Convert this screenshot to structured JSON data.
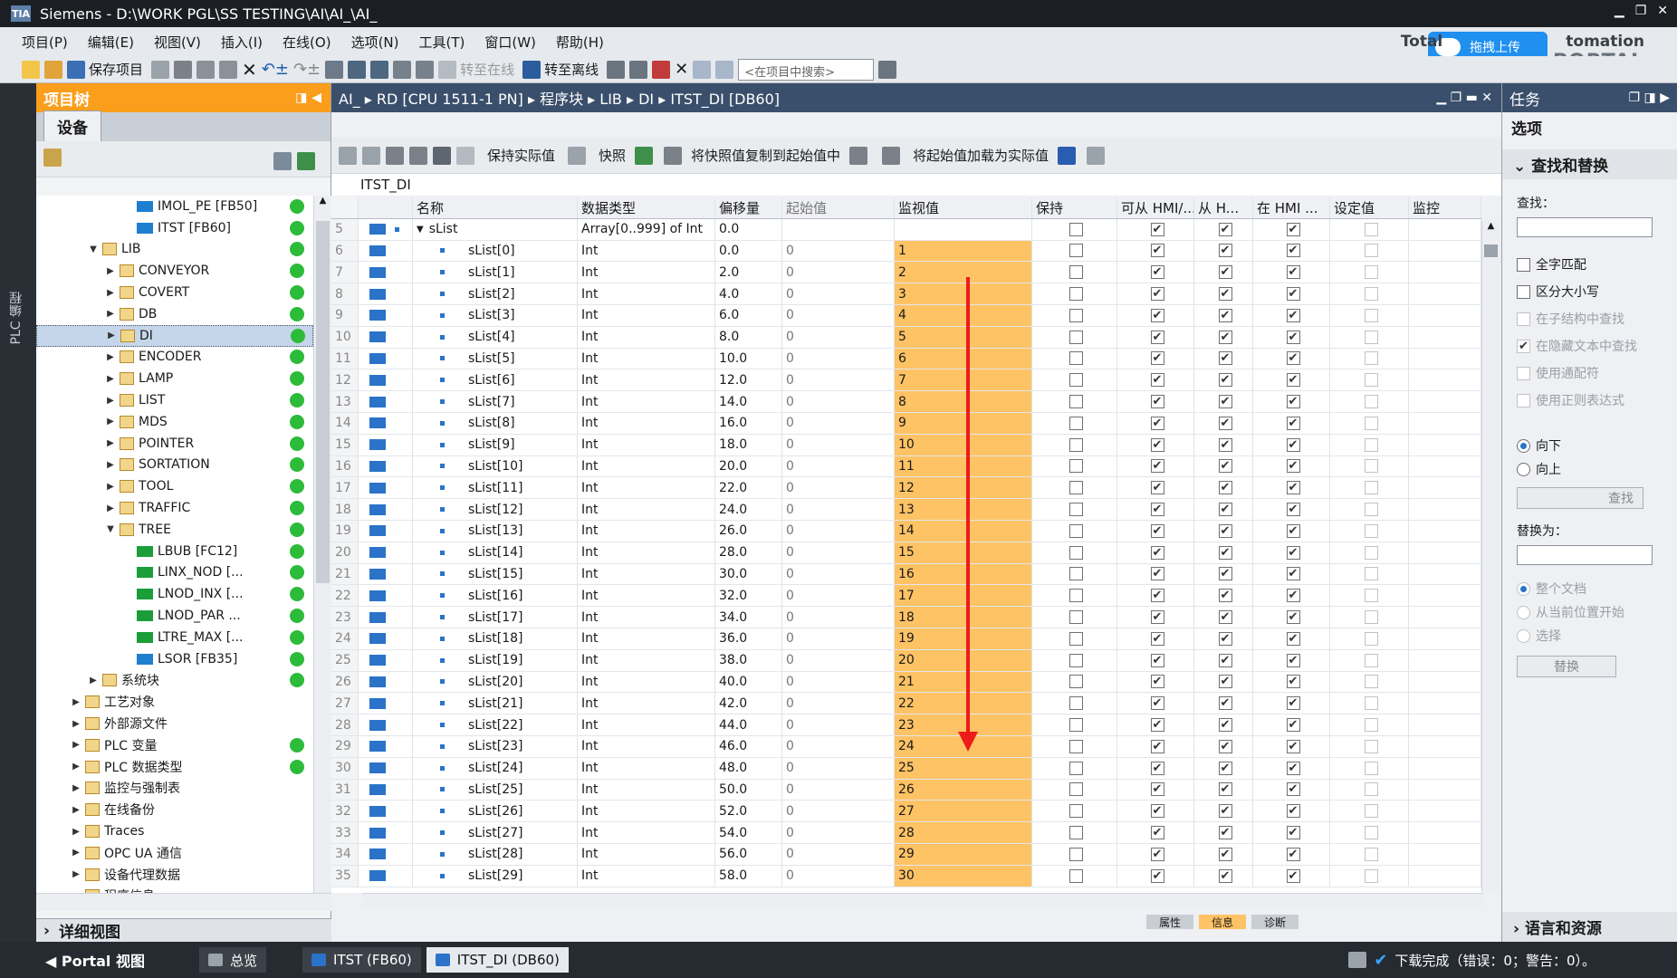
{
  "titlebar": {
    "title": "Siemens  -  D:\\WORK PGL\\SS TESTING\\AI\\AI_\\AI_",
    "logo": "TIA"
  },
  "menu": [
    "项目(P)",
    "编辑(E)",
    "视图(V)",
    "插入(I)",
    "在线(O)",
    "选项(N)",
    "工具(T)",
    "窗口(W)",
    "帮助(H)"
  ],
  "toolbar": {
    "save_label": "保存项目",
    "go_online": "转至在线",
    "go_offline": "转至离线",
    "search_placeholder": "<在项目中搜索>"
  },
  "brand": {
    "line1": "Totally Integrated Automation",
    "line1_visible": "Total",
    "line1_tail": "tomation",
    "line2": "PORTAL",
    "upload": "拖拽上传"
  },
  "vstrip": {
    "label": "PLC 编程"
  },
  "project_tree": {
    "title": "项目树",
    "tab": "设备",
    "items": [
      {
        "label": "IMOL_PE [FB50]",
        "indent": 5,
        "type": "block",
        "status": true
      },
      {
        "label": "ITST [FB60]",
        "indent": 5,
        "type": "block",
        "status": true
      },
      {
        "label": "LIB",
        "indent": 3,
        "type": "folder",
        "expand": "open",
        "status": true
      },
      {
        "label": "CONVEYOR",
        "indent": 4,
        "type": "folder",
        "expand": "closed",
        "status": true
      },
      {
        "label": "COVERT",
        "indent": 4,
        "type": "folder",
        "expand": "closed",
        "status": true
      },
      {
        "label": "DB",
        "indent": 4,
        "type": "folder",
        "expand": "closed",
        "status": true
      },
      {
        "label": "DI",
        "indent": 4,
        "type": "folder",
        "expand": "closed",
        "status": true,
        "selected": true
      },
      {
        "label": "ENCODER",
        "indent": 4,
        "type": "folder",
        "expand": "closed",
        "status": true
      },
      {
        "label": "LAMP",
        "indent": 4,
        "type": "folder",
        "expand": "closed",
        "status": true
      },
      {
        "label": "LIST",
        "indent": 4,
        "type": "folder",
        "expand": "closed",
        "status": true
      },
      {
        "label": "MDS",
        "indent": 4,
        "type": "folder",
        "expand": "closed",
        "status": true
      },
      {
        "label": "POINTER",
        "indent": 4,
        "type": "folder",
        "expand": "closed",
        "status": true
      },
      {
        "label": "SORTATION",
        "indent": 4,
        "type": "folder",
        "expand": "closed",
        "status": true
      },
      {
        "label": "TOOL",
        "indent": 4,
        "type": "folder",
        "expand": "closed",
        "status": true
      },
      {
        "label": "TRAFFIC",
        "indent": 4,
        "type": "folder",
        "expand": "closed",
        "status": true
      },
      {
        "label": "TREE",
        "indent": 4,
        "type": "folder",
        "expand": "open",
        "status": true
      },
      {
        "label": "LBUB [FC12]",
        "indent": 5,
        "type": "fc",
        "status": true
      },
      {
        "label": "LINX_NOD [...",
        "indent": 5,
        "type": "fc",
        "status": true
      },
      {
        "label": "LNOD_INX [...",
        "indent": 5,
        "type": "fc",
        "status": true
      },
      {
        "label": "LNOD_PAR ...",
        "indent": 5,
        "type": "fc",
        "status": true
      },
      {
        "label": "LTRE_MAX [...",
        "indent": 5,
        "type": "fc",
        "status": true
      },
      {
        "label": "LSOR [FB35]",
        "indent": 5,
        "type": "block",
        "status": true
      },
      {
        "label": "系统块",
        "indent": 3,
        "type": "folder",
        "expand": "closed",
        "status": true
      },
      {
        "label": "工艺对象",
        "indent": 2,
        "type": "folder",
        "expand": "closed",
        "status": false
      },
      {
        "label": "外部源文件",
        "indent": 2,
        "type": "folder",
        "expand": "closed",
        "status": false
      },
      {
        "label": "PLC 变量",
        "indent": 2,
        "type": "folder",
        "expand": "closed",
        "status": true
      },
      {
        "label": "PLC 数据类型",
        "indent": 2,
        "type": "folder",
        "expand": "closed",
        "status": true
      },
      {
        "label": "监控与强制表",
        "indent": 2,
        "type": "folder",
        "expand": "closed",
        "status": false
      },
      {
        "label": "在线备份",
        "indent": 2,
        "type": "folder",
        "expand": "closed",
        "status": false
      },
      {
        "label": "Traces",
        "indent": 2,
        "type": "folder",
        "expand": "closed",
        "status": false
      },
      {
        "label": "OPC UA 通信",
        "indent": 2,
        "type": "folder",
        "expand": "closed",
        "status": false
      },
      {
        "label": "设备代理数据",
        "indent": 2,
        "type": "folder",
        "expand": "closed",
        "status": false
      },
      {
        "label": "程序信息",
        "indent": 2,
        "type": "folder",
        "expand": "none",
        "status": false
      }
    ],
    "detail_view": "详细视图"
  },
  "editor": {
    "breadcrumb": "AI_  ▸  RD [CPU 1511-1 PN]  ▸  程序块  ▸  LIB  ▸  DI  ▸  ITST_DI [DB60]",
    "tools": {
      "keep_actual": "保持实际值",
      "snapshot": "快照",
      "copy_snapshot": "将快照值复制到起始值中",
      "load_start": "将起始值加载为实际值"
    },
    "db_name": "ITST_DI",
    "columns": [
      "",
      "名称",
      "数据类型",
      "偏移量",
      "起始值",
      "监视值",
      "保持",
      "可从 HMI/...",
      "从 H...",
      "在 HMI ...",
      "设定值",
      "监控"
    ],
    "header_row": {
      "num": "5",
      "name": "sList",
      "type": "Array[0..999] of Int",
      "offset": "0.0"
    },
    "rows": [
      {
        "num": "6",
        "name": "sList[0]",
        "type": "Int",
        "offset": "0.0",
        "start": "0",
        "monitor": "1"
      },
      {
        "num": "7",
        "name": "sList[1]",
        "type": "Int",
        "offset": "2.0",
        "start": "0",
        "monitor": "2"
      },
      {
        "num": "8",
        "name": "sList[2]",
        "type": "Int",
        "offset": "4.0",
        "start": "0",
        "monitor": "3"
      },
      {
        "num": "9",
        "name": "sList[3]",
        "type": "Int",
        "offset": "6.0",
        "start": "0",
        "monitor": "4"
      },
      {
        "num": "10",
        "name": "sList[4]",
        "type": "Int",
        "offset": "8.0",
        "start": "0",
        "monitor": "5"
      },
      {
        "num": "11",
        "name": "sList[5]",
        "type": "Int",
        "offset": "10.0",
        "start": "0",
        "monitor": "6"
      },
      {
        "num": "12",
        "name": "sList[6]",
        "type": "Int",
        "offset": "12.0",
        "start": "0",
        "monitor": "7"
      },
      {
        "num": "13",
        "name": "sList[7]",
        "type": "Int",
        "offset": "14.0",
        "start": "0",
        "monitor": "8"
      },
      {
        "num": "14",
        "name": "sList[8]",
        "type": "Int",
        "offset": "16.0",
        "start": "0",
        "monitor": "9"
      },
      {
        "num": "15",
        "name": "sList[9]",
        "type": "Int",
        "offset": "18.0",
        "start": "0",
        "monitor": "10"
      },
      {
        "num": "16",
        "name": "sList[10]",
        "type": "Int",
        "offset": "20.0",
        "start": "0",
        "monitor": "11"
      },
      {
        "num": "17",
        "name": "sList[11]",
        "type": "Int",
        "offset": "22.0",
        "start": "0",
        "monitor": "12"
      },
      {
        "num": "18",
        "name": "sList[12]",
        "type": "Int",
        "offset": "24.0",
        "start": "0",
        "monitor": "13"
      },
      {
        "num": "19",
        "name": "sList[13]",
        "type": "Int",
        "offset": "26.0",
        "start": "0",
        "monitor": "14"
      },
      {
        "num": "20",
        "name": "sList[14]",
        "type": "Int",
        "offset": "28.0",
        "start": "0",
        "monitor": "15"
      },
      {
        "num": "21",
        "name": "sList[15]",
        "type": "Int",
        "offset": "30.0",
        "start": "0",
        "monitor": "16"
      },
      {
        "num": "22",
        "name": "sList[16]",
        "type": "Int",
        "offset": "32.0",
        "start": "0",
        "monitor": "17"
      },
      {
        "num": "23",
        "name": "sList[17]",
        "type": "Int",
        "offset": "34.0",
        "start": "0",
        "monitor": "18"
      },
      {
        "num": "24",
        "name": "sList[18]",
        "type": "Int",
        "offset": "36.0",
        "start": "0",
        "monitor": "19"
      },
      {
        "num": "25",
        "name": "sList[19]",
        "type": "Int",
        "offset": "38.0",
        "start": "0",
        "monitor": "20"
      },
      {
        "num": "26",
        "name": "sList[20]",
        "type": "Int",
        "offset": "40.0",
        "start": "0",
        "monitor": "21"
      },
      {
        "num": "27",
        "name": "sList[21]",
        "type": "Int",
        "offset": "42.0",
        "start": "0",
        "monitor": "22"
      },
      {
        "num": "28",
        "name": "sList[22]",
        "type": "Int",
        "offset": "44.0",
        "start": "0",
        "monitor": "23"
      },
      {
        "num": "29",
        "name": "sList[23]",
        "type": "Int",
        "offset": "46.0",
        "start": "0",
        "monitor": "24"
      },
      {
        "num": "30",
        "name": "sList[24]",
        "type": "Int",
        "offset": "48.0",
        "start": "0",
        "monitor": "25"
      },
      {
        "num": "31",
        "name": "sList[25]",
        "type": "Int",
        "offset": "50.0",
        "start": "0",
        "monitor": "26"
      },
      {
        "num": "32",
        "name": "sList[26]",
        "type": "Int",
        "offset": "52.0",
        "start": "0",
        "monitor": "27"
      },
      {
        "num": "33",
        "name": "sList[27]",
        "type": "Int",
        "offset": "54.0",
        "start": "0",
        "monitor": "28"
      },
      {
        "num": "34",
        "name": "sList[28]",
        "type": "Int",
        "offset": "56.0",
        "start": "0",
        "monitor": "29"
      },
      {
        "num": "35",
        "name": "sList[29]",
        "type": "Int",
        "offset": "58.0",
        "start": "0",
        "monitor": "30"
      }
    ],
    "bottom_tabs": [
      "属性",
      "信息",
      "诊断"
    ]
  },
  "tasks": {
    "title": "任务",
    "options": "选项",
    "find_replace": "查找和替换",
    "find_label": "查找：",
    "checks": [
      {
        "label": "全字匹配",
        "checked": false,
        "disabled": false
      },
      {
        "label": "区分大小写",
        "checked": false,
        "disabled": false
      },
      {
        "label": "在子结构中查找",
        "checked": false,
        "disabled": true
      },
      {
        "label": "在隐藏文本中查找",
        "checked": true,
        "disabled": true
      },
      {
        "label": "使用通配符",
        "checked": false,
        "disabled": true
      },
      {
        "label": "使用正则表达式",
        "checked": false,
        "disabled": true
      }
    ],
    "dir_down": "向下",
    "dir_up": "向上",
    "find_button": "查找",
    "replace_label": "替换为：",
    "scope": [
      "整个文档",
      "从当前位置开始",
      "选择"
    ],
    "replace_button": "替换",
    "lang_resources": "语言和资源"
  },
  "statusbar": {
    "portal": "Portal 视图",
    "tabs": [
      "总览",
      "ITST (FB60)",
      "ITST_DI (DB60)"
    ],
    "message": "下载完成（错误：0；警告：0）。"
  },
  "colors": {
    "orange_header": "#fb9e1b",
    "monitor_cell": "#fec365",
    "status_green": "#2dbb3a",
    "annotation_arrow": "#ee1b1b",
    "titlebar": "#1b1f24"
  }
}
